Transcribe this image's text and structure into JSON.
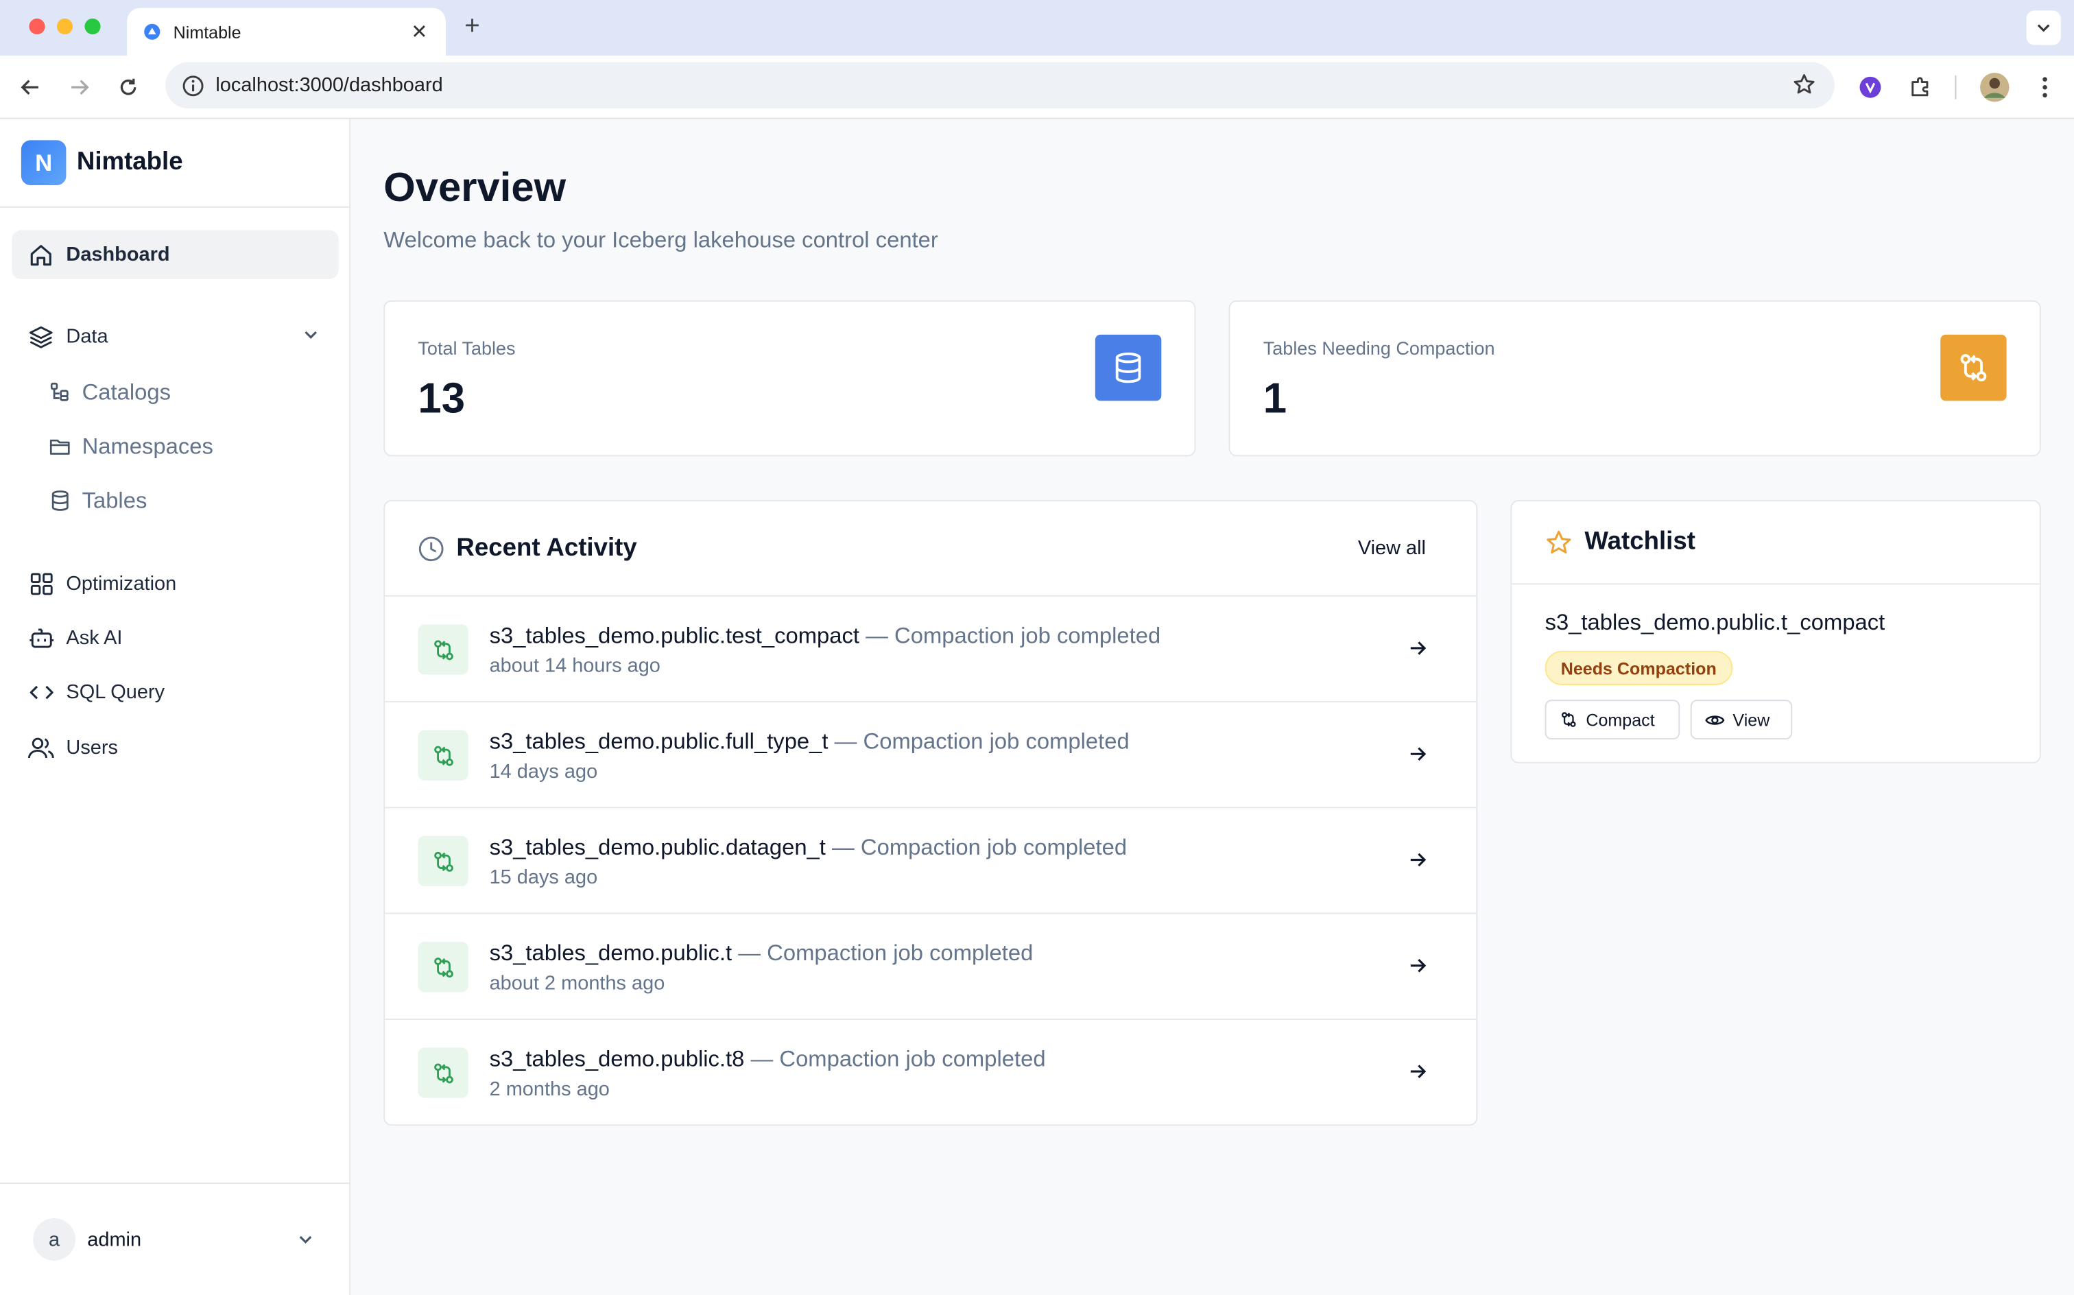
{
  "browser": {
    "tab_title": "Nimtable",
    "url": "localhost:3000/dashboard"
  },
  "sidebar": {
    "brand_letter": "N",
    "brand_name": "Nimtable",
    "items": [
      {
        "label": "Dashboard",
        "icon": "home-icon",
        "active": true
      },
      {
        "label": "Data",
        "icon": "layers-icon"
      },
      {
        "label": "Catalogs",
        "icon": "catalog-icon"
      },
      {
        "label": "Namespaces",
        "icon": "folder-icon"
      },
      {
        "label": "Tables",
        "icon": "database-icon"
      },
      {
        "label": "Optimization",
        "icon": "grid-icon"
      },
      {
        "label": "Ask AI",
        "icon": "bot-icon"
      },
      {
        "label": "SQL Query",
        "icon": "code-icon"
      },
      {
        "label": "Users",
        "icon": "users-icon"
      }
    ],
    "user": {
      "initial": "a",
      "name": "admin"
    }
  },
  "header": {
    "title": "Overview",
    "subtitle": "Welcome back to your Iceberg lakehouse control center"
  },
  "stats": [
    {
      "label": "Total Tables",
      "value": "13",
      "icon": "database-icon",
      "color": "#4a7fe8"
    },
    {
      "label": "Tables Needing Compaction",
      "value": "1",
      "icon": "git-compare-icon",
      "color": "#eda333"
    }
  ],
  "activity": {
    "title": "Recent Activity",
    "view_all": "View all",
    "items": [
      {
        "table": "s3_tables_demo.public.test_compact",
        "event": " — Compaction job completed",
        "time": "about 14 hours ago"
      },
      {
        "table": "s3_tables_demo.public.full_type_t",
        "event": " — Compaction job completed",
        "time": "14 days ago"
      },
      {
        "table": "s3_tables_demo.public.datagen_t",
        "event": " — Compaction job completed",
        "time": "15 days ago"
      },
      {
        "table": "s3_tables_demo.public.t",
        "event": " — Compaction job completed",
        "time": "about 2 months ago"
      },
      {
        "table": "s3_tables_demo.public.t8",
        "event": " — Compaction job completed",
        "time": "2 months ago"
      }
    ]
  },
  "watchlist": {
    "title": "Watchlist",
    "table": "s3_tables_demo.public.t_compact",
    "badge": "Needs Compaction",
    "compact_label": "Compact",
    "view_label": "View"
  }
}
